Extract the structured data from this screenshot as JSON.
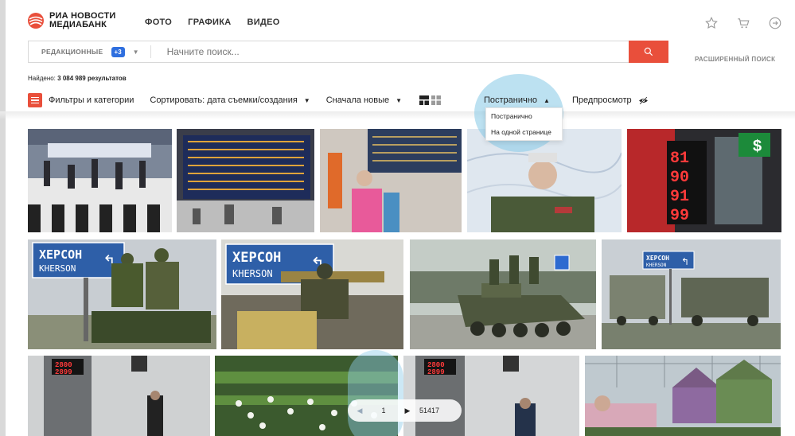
{
  "brand": {
    "line1": "РИА НОВОСТИ",
    "line2": "МЕДИАБАНК"
  },
  "nav": [
    "ФОТО",
    "ГРАФИКА",
    "ВИДЕО"
  ],
  "header_icons": [
    "star-icon",
    "cart-icon",
    "login-icon"
  ],
  "search": {
    "scope": "РЕДАКЦИОННЫЕ",
    "badge": "+3",
    "placeholder": "Начните поиск...",
    "advanced": "РАСШИРЕННЫЙ ПОИСК"
  },
  "results": {
    "label": "Найдено:",
    "count": "3 084 989 результатов"
  },
  "toolbar": {
    "filters": "Фильтры и категории",
    "sort": "Сортировать: дата съемки/создания",
    "order": "Сначала новые",
    "paging": "Постранично",
    "preview": "Предпросмотр"
  },
  "paging_menu": [
    "Постранично",
    "На одной странице"
  ],
  "photos": [
    {
      "sign_text": ""
    },
    {
      "sign_text": ""
    },
    {
      "sign_text": ""
    },
    {
      "sign_text": ""
    },
    {
      "sign_text": ""
    },
    {
      "sign_text": "ХЕРСОН\nKHERSON"
    },
    {
      "sign_text": "ХЕРСОН\nKHERSON"
    },
    {
      "sign_text": ""
    },
    {
      "sign_text": "ХЕРСОН\nKHERSON"
    },
    {
      "sign_text": ""
    },
    {
      "sign_text": ""
    },
    {
      "sign_text": ""
    },
    {
      "sign_text": ""
    }
  ],
  "pager": {
    "current": "1",
    "total": "51417"
  },
  "colors": {
    "accent": "#e94f3b",
    "badge": "#2f6fdf",
    "highlight": "#8fcde8"
  }
}
